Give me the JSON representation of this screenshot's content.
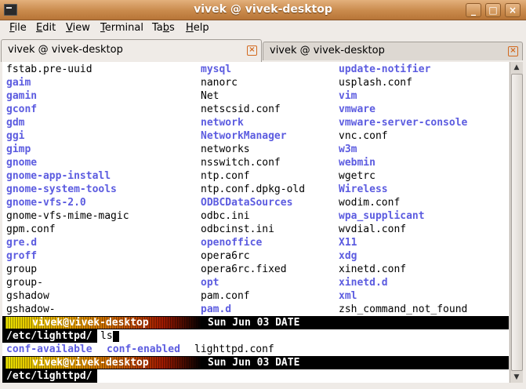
{
  "window": {
    "title": "vivek @ vivek-desktop",
    "buttons": {
      "minimize": "_",
      "maximize": "□",
      "close": "×"
    }
  },
  "menu": [
    "File",
    "Edit",
    "View",
    "Terminal",
    "Tabs",
    "Help"
  ],
  "menu_mnemonics": [
    "F",
    "E",
    "V",
    "T",
    "b",
    "H"
  ],
  "tabs": [
    {
      "label": "vivek @ vivek-desktop",
      "active": true
    },
    {
      "label": "vivek @ vivek-desktop",
      "active": false
    }
  ],
  "listing": [
    [
      [
        "fstab.pre-uuid",
        "f"
      ],
      [
        "mysql",
        "d"
      ],
      [
        "update-notifier",
        "d"
      ]
    ],
    [
      [
        "gaim",
        "d"
      ],
      [
        "nanorc",
        "f"
      ],
      [
        "usplash.conf",
        "f"
      ]
    ],
    [
      [
        "gamin",
        "d"
      ],
      [
        "Net",
        "f"
      ],
      [
        "vim",
        "d"
      ]
    ],
    [
      [
        "gconf",
        "d"
      ],
      [
        "netscsid.conf",
        "f"
      ],
      [
        "vmware",
        "d"
      ]
    ],
    [
      [
        "gdm",
        "d"
      ],
      [
        "network",
        "d"
      ],
      [
        "vmware-server-console",
        "d"
      ]
    ],
    [
      [
        "ggi",
        "d"
      ],
      [
        "NetworkManager",
        "d"
      ],
      [
        "vnc.conf",
        "f"
      ]
    ],
    [
      [
        "gimp",
        "d"
      ],
      [
        "networks",
        "f"
      ],
      [
        "w3m",
        "d"
      ]
    ],
    [
      [
        "gnome",
        "d"
      ],
      [
        "nsswitch.conf",
        "f"
      ],
      [
        "webmin",
        "d"
      ]
    ],
    [
      [
        "gnome-app-install",
        "d"
      ],
      [
        "ntp.conf",
        "f"
      ],
      [
        "wgetrc",
        "f"
      ]
    ],
    [
      [
        "gnome-system-tools",
        "d"
      ],
      [
        "ntp.conf.dpkg-old",
        "f"
      ],
      [
        "Wireless",
        "d"
      ]
    ],
    [
      [
        "gnome-vfs-2.0",
        "d"
      ],
      [
        "ODBCDataSources",
        "d"
      ],
      [
        "wodim.conf",
        "f"
      ]
    ],
    [
      [
        "gnome-vfs-mime-magic",
        "f"
      ],
      [
        "odbc.ini",
        "f"
      ],
      [
        "wpa_supplicant",
        "d"
      ]
    ],
    [
      [
        "gpm.conf",
        "f"
      ],
      [
        "odbcinst.ini",
        "f"
      ],
      [
        "wvdial.conf",
        "f"
      ]
    ],
    [
      [
        "gre.d",
        "d"
      ],
      [
        "openoffice",
        "d"
      ],
      [
        "X11",
        "d"
      ]
    ],
    [
      [
        "groff",
        "d"
      ],
      [
        "opera6rc",
        "f"
      ],
      [
        "xdg",
        "d"
      ]
    ],
    [
      [
        "group",
        "f"
      ],
      [
        "opera6rc.fixed",
        "f"
      ],
      [
        "xinetd.conf",
        "f"
      ]
    ],
    [
      [
        "group-",
        "f"
      ],
      [
        "opt",
        "d"
      ],
      [
        "xinetd.d",
        "d"
      ]
    ],
    [
      [
        "gshadow",
        "f"
      ],
      [
        "pam.conf",
        "f"
      ],
      [
        "xml",
        "d"
      ]
    ],
    [
      [
        "gshadow-",
        "f"
      ],
      [
        "pam.d",
        "d"
      ],
      [
        "zsh_command_not_found",
        "f"
      ]
    ]
  ],
  "prompt": {
    "user_host": "vivek@vivek-desktop",
    "date": "Sun Jun 03 DATE",
    "cwd": "/etc/lighttpd/"
  },
  "command1": "ls",
  "ls_output": [
    [
      "conf-available",
      "d"
    ],
    [
      "conf-enabled",
      "d"
    ],
    [
      "lighttpd.conf",
      "f"
    ]
  ],
  "command2": "",
  "colors": {
    "directory": "#5c5ce0",
    "titlebar": "#c98a4c",
    "tab_close": "#d2691e"
  }
}
